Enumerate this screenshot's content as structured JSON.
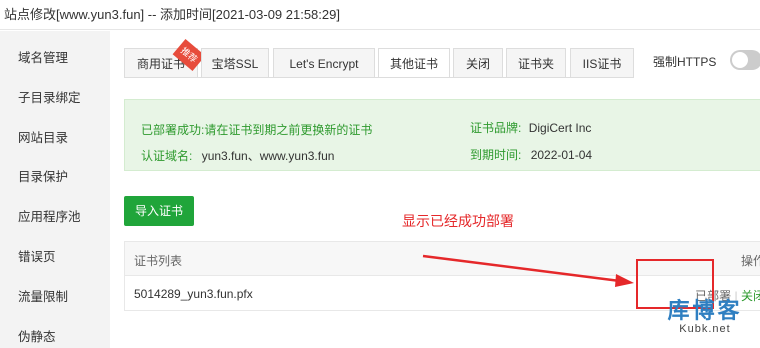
{
  "window": {
    "title": "站点修改[www.yun3.fun] -- 添加时间[2021-03-09 21:58:29]"
  },
  "sidebar": {
    "items": [
      {
        "label": "域名管理"
      },
      {
        "label": "子目录绑定"
      },
      {
        "label": "网站目录"
      },
      {
        "label": "目录保护"
      },
      {
        "label": "应用程序池"
      },
      {
        "label": "错误页"
      },
      {
        "label": "流量限制"
      },
      {
        "label": "伪静态"
      }
    ]
  },
  "tabs": [
    {
      "label": "商用证书",
      "badge": "推荐"
    },
    {
      "label": "宝塔SSL"
    },
    {
      "label": "Let's Encrypt"
    },
    {
      "label": "其他证书",
      "active": true
    },
    {
      "label": "关闭"
    },
    {
      "label": "证书夹"
    },
    {
      "label": "IIS证书"
    }
  ],
  "https_toggle": {
    "label": "强制HTTPS",
    "on": false
  },
  "status": {
    "deploy_label": "已部署成功:",
    "deploy_text": "请在证书到期之前更换新的证书",
    "brand_label": "证书品牌:",
    "brand_value": "DigiCert Inc",
    "domain_label": "认证域名:",
    "domain_value": "yun3.fun、www.yun3.fun",
    "expiry_label": "到期时间:",
    "expiry_value": "2022-01-04"
  },
  "import_button": "导入证书",
  "annotation": "显示已经成功部署",
  "cert_table": {
    "headers": [
      "证书列表",
      "操作"
    ],
    "rows": [
      {
        "name": "5014289_yun3.fun.pfx",
        "status": "已部署",
        "separator": "|",
        "action": "关闭"
      }
    ]
  },
  "watermark": {
    "main": "库博客",
    "sub": "Kubk.net"
  },
  "colors": {
    "accent": "#20a53a",
    "annotation": "#e5282a",
    "watermark": "#2f7fc1"
  }
}
